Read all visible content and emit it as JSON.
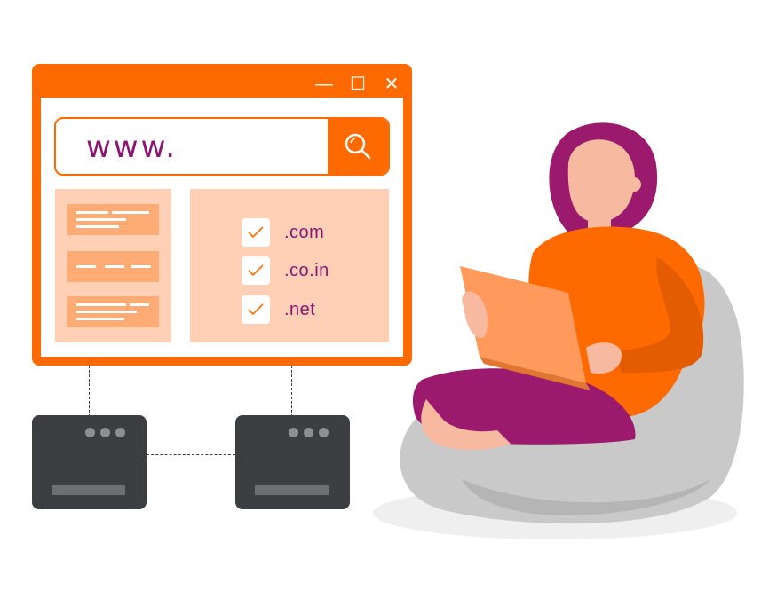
{
  "browser": {
    "controls": {
      "minimize": "—",
      "maximize": "☐",
      "close": "✕"
    },
    "address_bar": {
      "value": "www."
    }
  },
  "domain_list": {
    "items": [
      {
        "label": ".com",
        "checked": true
      },
      {
        "label": ".co.in",
        "checked": true
      },
      {
        "label": ".net",
        "checked": true
      }
    ]
  },
  "colors": {
    "accent": "#ff6a00",
    "panel": "#ffd0b5",
    "text_purple": "#8b1572",
    "server": "#3c3e42"
  }
}
